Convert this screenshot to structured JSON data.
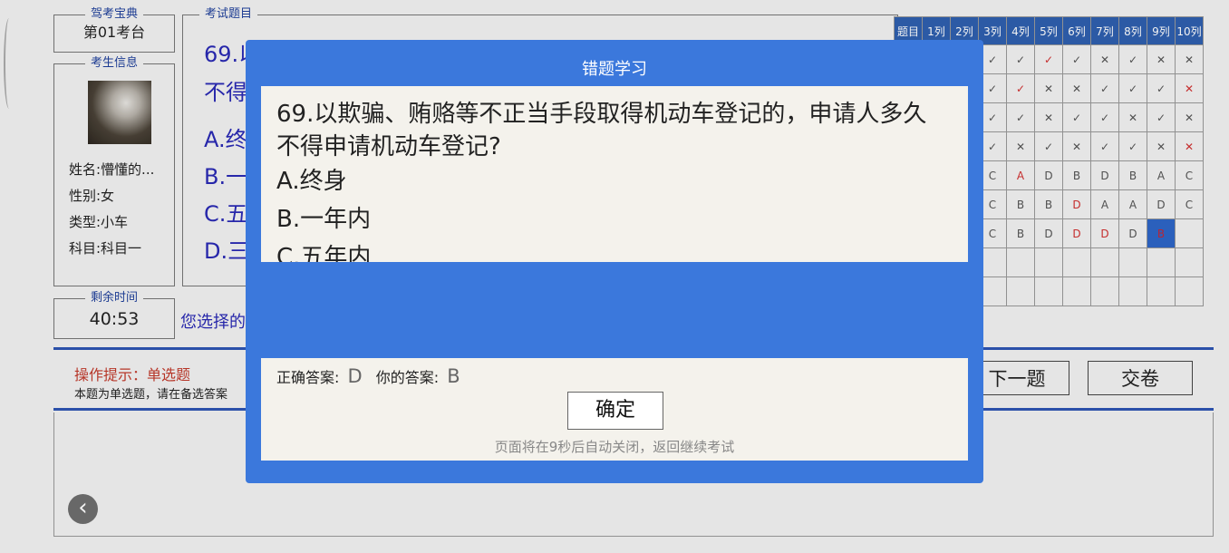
{
  "left_panel": {
    "exam_book_legend": "驾考宝典",
    "seat": "第01考台",
    "candidate_legend": "考生信息",
    "name": "姓名:懵懂的...",
    "gender": "性别:女",
    "vehicle_type": "类型:小车",
    "subject": "科目:科目一",
    "time_legend": "剩余时间",
    "time_left": "40:53"
  },
  "question_area": {
    "legend": "考试题目",
    "line1": "69.以",
    "line2": "不得",
    "option_a": "A.终",
    "option_b": "B.一",
    "option_c": "C.五",
    "option_d": "D.三",
    "chosen_label": "您选择的"
  },
  "answer_grid": {
    "headers": [
      "题目",
      "1列",
      "2列",
      "3列",
      "4列",
      "5列",
      "6列",
      "7列",
      "8列",
      "9列",
      "10列"
    ],
    "rows": [
      [
        "",
        "",
        "",
        "✓",
        "✓",
        "✓",
        "✓",
        "✕",
        "✓",
        "✕",
        "✕"
      ],
      [
        "",
        "",
        "",
        "✓",
        "✓",
        "✕",
        "✕",
        "✓",
        "✓",
        "✓",
        "✕"
      ],
      [
        "",
        "",
        "",
        "✓",
        "✓",
        "✕",
        "✓",
        "✓",
        "✕",
        "✓",
        "✕"
      ],
      [
        "",
        "",
        "",
        "✓",
        "✕",
        "✓",
        "✕",
        "✓",
        "✓",
        "✕",
        "✕"
      ],
      [
        "",
        "",
        "",
        "C",
        "A",
        "D",
        "B",
        "D",
        "B",
        "A",
        "C"
      ],
      [
        "",
        "",
        "",
        "C",
        "B",
        "B",
        "D",
        "A",
        "A",
        "D",
        "C"
      ],
      [
        "",
        "",
        "",
        "C",
        "B",
        "D",
        "D",
        "D",
        "D",
        "B",
        ""
      ],
      [
        "",
        "",
        "",
        "",
        "",
        "",
        "",
        "",
        "",
        "",
        ""
      ],
      [
        "",
        "",
        "",
        "",
        "",
        "",
        "",
        "",
        "",
        "",
        ""
      ]
    ],
    "red_cells": [
      "0-5",
      "1-4",
      "1-10",
      "3-10",
      "4-4",
      "5-6",
      "6-6",
      "6-7"
    ],
    "selected_cell": "6-9"
  },
  "hint": {
    "title": "操作提示：单选题",
    "text": "本题为单选题，请在备选答案"
  },
  "buttons": {
    "next": "下一题",
    "submit": "交卷",
    "back_icon": "chevron-left-icon"
  },
  "dialog": {
    "title": "错题学习",
    "question_line1": "69.以欺骗、贿赂等不正当手段取得机动车登记的，申请人多久",
    "question_line2": "不得申请机动车登记?",
    "option_a": "A.终身",
    "option_b": "B.一年内",
    "option_c": "C.五年内",
    "correct_label": "正确答案:",
    "correct_value": "D",
    "yours_label": "你的答案:",
    "yours_value": "B",
    "ok": "确定",
    "auto_close": "页面将在9秒后自动关闭，返回继续考试"
  },
  "colors": {
    "dialog_bg": "#3b78dc",
    "accent_blue": "#2a2ab4",
    "error_red": "#d03030"
  }
}
